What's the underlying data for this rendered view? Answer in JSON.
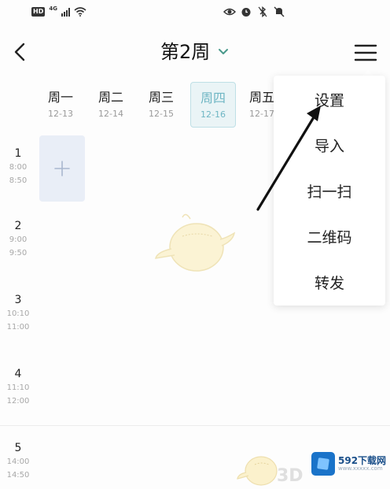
{
  "status_bar": {
    "hd": "HD",
    "network": "4G"
  },
  "header": {
    "week_title": "第2周"
  },
  "days": [
    {
      "name": "周一",
      "date": "12-13"
    },
    {
      "name": "周二",
      "date": "12-14"
    },
    {
      "name": "周三",
      "date": "12-15"
    },
    {
      "name": "周四",
      "date": "12-16",
      "active": true
    },
    {
      "name": "周五",
      "date": "12-17"
    }
  ],
  "slots": [
    {
      "no": "1",
      "start": "8:00",
      "end": "8:50"
    },
    {
      "no": "2",
      "start": "9:00",
      "end": "9:50"
    },
    {
      "no": "3",
      "start": "10:10",
      "end": "11:00"
    },
    {
      "no": "4",
      "start": "11:10",
      "end": "12:00"
    },
    {
      "no": "5",
      "start": "14:00",
      "end": "14:50"
    }
  ],
  "menu": {
    "items": [
      "设置",
      "导入",
      "扫一扫",
      "二维码",
      "转发"
    ]
  },
  "watermark": {
    "brand": "592下载网",
    "sub": "www.xxxxx.com",
    "mark": "3D"
  },
  "colors": {
    "accent": "#6fb6c4",
    "add_cell": "#e9eef7",
    "arrow": "#111111"
  }
}
